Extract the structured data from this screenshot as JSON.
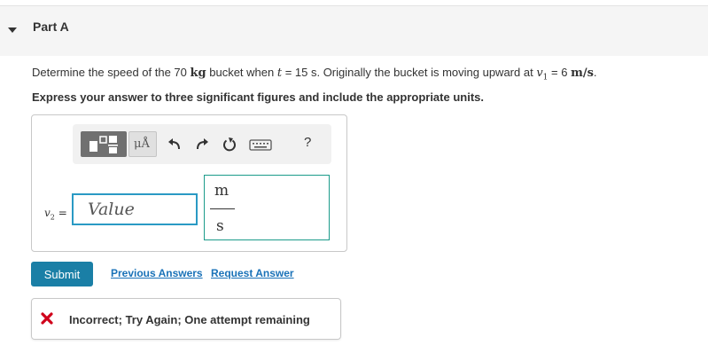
{
  "part": {
    "title": "Part A"
  },
  "question": {
    "text_a": "Determine the speed of the 70 ",
    "mass_unit": "kg",
    "text_b": " bucket when ",
    "time_var": "t",
    "text_c": " = 15 s. Originally the bucket is moving upward at ",
    "vel_var": "v",
    "vel_sub": "1",
    "text_d": " = 6 ",
    "vel_unit": "m/s",
    "text_e": "."
  },
  "instructions": "Express your answer to three significant figures and include the appropriate units.",
  "toolbar": {
    "units_label": "μÅ",
    "help_label": "?"
  },
  "answer": {
    "var": "v",
    "var_sub": "2",
    "equals": " =",
    "value_placeholder": "Value",
    "unit_numerator": "m",
    "unit_denominator": "s"
  },
  "actions": {
    "submit_label": "Submit",
    "previous_answers_label": "Previous Answers",
    "request_answer_label": "Request Answer"
  },
  "feedback": {
    "status": "incorrect",
    "text": "Incorrect; Try Again; One attempt remaining",
    "icon_color": "#d0021b"
  },
  "colors": {
    "submit_bg": "#1a7fa6",
    "link": "#1a72b8",
    "input_border": "#2a9ac4",
    "units_border": "#1b9b8a"
  }
}
